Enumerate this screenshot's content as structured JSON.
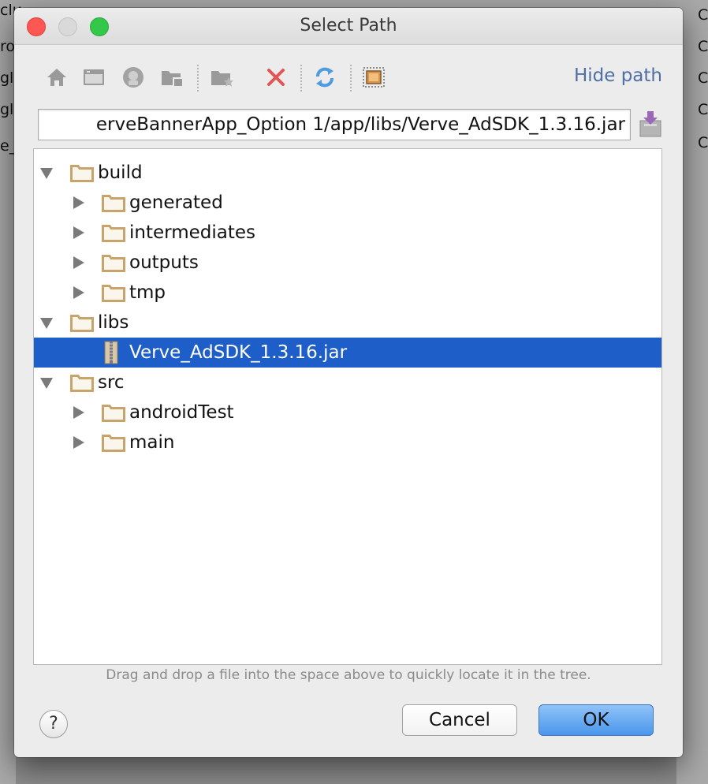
{
  "background_fragments": [
    "clu",
    "ro",
    "gle",
    "gle",
    "e_",
    "C",
    "C",
    "C",
    "C",
    "C"
  ],
  "window": {
    "title": "Select Path"
  },
  "toolbar": {
    "buttons": [
      {
        "icon": "home-icon"
      },
      {
        "icon": "desktop-icon"
      },
      {
        "icon": "android-project-icon"
      },
      {
        "icon": "module-icon"
      },
      {
        "icon": "new-folder-icon"
      },
      {
        "icon": "delete-icon"
      },
      {
        "icon": "refresh-icon"
      },
      {
        "icon": "show-hidden-icon"
      }
    ],
    "hide_path_label": "Hide path"
  },
  "path_field": {
    "value": "erveBannerApp_Option 1/app/libs/Verve_AdSDK_1.3.16.jar"
  },
  "tree": {
    "items": [
      {
        "label": "build",
        "type": "folder",
        "depth": 0,
        "expanded": true,
        "selected": false
      },
      {
        "label": "generated",
        "type": "folder",
        "depth": 1,
        "expanded": false,
        "selected": false
      },
      {
        "label": "intermediates",
        "type": "folder",
        "depth": 1,
        "expanded": false,
        "selected": false
      },
      {
        "label": "outputs",
        "type": "folder",
        "depth": 1,
        "expanded": false,
        "selected": false
      },
      {
        "label": "tmp",
        "type": "folder",
        "depth": 1,
        "expanded": false,
        "selected": false
      },
      {
        "label": "libs",
        "type": "folder",
        "depth": 0,
        "expanded": true,
        "selected": false
      },
      {
        "label": "Verve_AdSDK_1.3.16.jar",
        "type": "jar",
        "depth": 1,
        "expanded": null,
        "selected": true
      },
      {
        "label": "src",
        "type": "folder",
        "depth": 0,
        "expanded": true,
        "selected": false
      },
      {
        "label": "androidTest",
        "type": "folder",
        "depth": 1,
        "expanded": false,
        "selected": false
      },
      {
        "label": "main",
        "type": "folder",
        "depth": 1,
        "expanded": false,
        "selected": false
      }
    ]
  },
  "hint": "Drag and drop a file into the space above to quickly locate it in the tree.",
  "buttons": {
    "help": "?",
    "cancel": "Cancel",
    "ok": "OK"
  },
  "colors": {
    "selection": "#1e5ec8",
    "link": "#4d6fa3",
    "folder": "#c9a46a"
  }
}
